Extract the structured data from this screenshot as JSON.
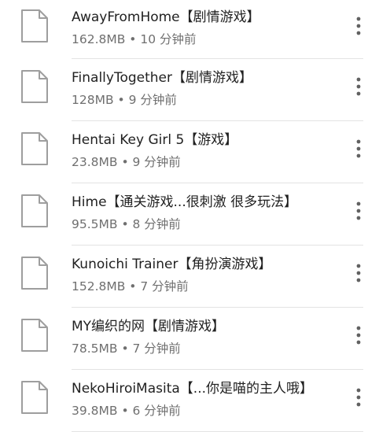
{
  "files": [
    {
      "name": "AwayFromHome【剧情游戏】",
      "meta": "162.8MB • 10 分钟前",
      "icon": "document-icon",
      "menu_icon": "more-vert-icon"
    },
    {
      "name": "FinallyTogether【剧情游戏】",
      "meta": "128MB • 9 分钟前",
      "icon": "document-icon",
      "menu_icon": "more-vert-icon"
    },
    {
      "name": "Hentai Key Girl 5【游戏】",
      "meta": "23.8MB • 9 分钟前",
      "icon": "document-icon",
      "menu_icon": "more-vert-icon"
    },
    {
      "name": "Hime【通关游戏...很刺激 很多玩法】",
      "meta": "95.5MB • 8 分钟前",
      "icon": "document-icon",
      "menu_icon": "more-vert-icon"
    },
    {
      "name": "Kunoichi Trainer【角扮演游戏】",
      "meta": "152.8MB • 7 分钟前",
      "icon": "document-icon",
      "menu_icon": "more-vert-icon"
    },
    {
      "name": "MY编织的网【剧情游戏】",
      "meta": "78.5MB • 7 分钟前",
      "icon": "document-icon",
      "menu_icon": "more-vert-icon"
    },
    {
      "name": "NekoHiroiMasita【...你是喵的主人哦】",
      "meta": "39.8MB • 6 分钟前",
      "icon": "document-icon",
      "menu_icon": "more-vert-icon"
    }
  ],
  "colors": {
    "title": "#212121",
    "meta": "#6f6f6f",
    "icon_stroke": "#9e9e9e",
    "menu_dots": "#616161",
    "divider": "#e3e3e3"
  }
}
